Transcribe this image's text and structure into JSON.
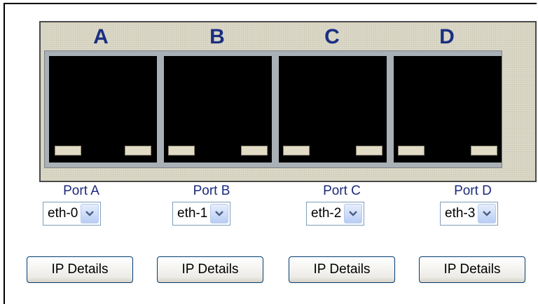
{
  "ports": [
    {
      "letter": "A",
      "label": "Port A",
      "interface": "eth-0",
      "button": "IP Details"
    },
    {
      "letter": "B",
      "label": "Port B",
      "interface": "eth-1",
      "button": "IP Details"
    },
    {
      "letter": "C",
      "label": "Port C",
      "interface": "eth-2",
      "button": "IP Details"
    },
    {
      "letter": "D",
      "label": "Port D",
      "interface": "eth-3",
      "button": "IP Details"
    }
  ],
  "colors": {
    "letter": "#1a2f82",
    "panel": "#dcd9c8",
    "jack": "#000000",
    "label": "#1d2a7a"
  },
  "icons": {
    "dropdown": "chevron-down-icon"
  }
}
